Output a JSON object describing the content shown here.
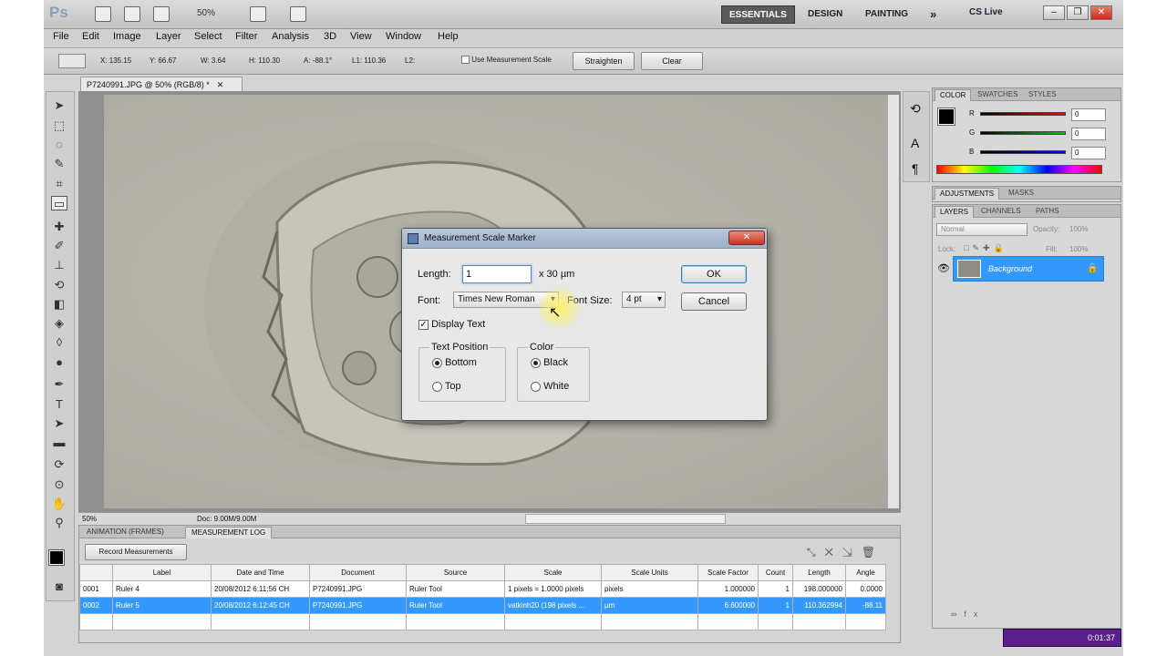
{
  "app": {
    "logo": "Ps",
    "zoom": "50%",
    "workspaces": [
      "ESSENTIALS",
      "DESIGN",
      "PAINTING"
    ],
    "more": "»",
    "cslive": "CS Live"
  },
  "menu": [
    "File",
    "Edit",
    "Image",
    "Layer",
    "Select",
    "Filter",
    "Analysis",
    "3D",
    "View",
    "Window",
    "Help"
  ],
  "options": {
    "x": "X: 135.15",
    "y": "Y: 66.67",
    "w": "W: 3.64",
    "h": "H: 110.30",
    "a": "A: -88.1°",
    "l1": "L1: 110.36",
    "l2": "L2:",
    "use_scale": "Use Measurement Scale",
    "straighten": "Straighten",
    "clear": "Clear"
  },
  "document": {
    "tab": "P7240991.JPG @ 50% (RGB/8) *",
    "zoom": "50%",
    "doc_size": "Doc: 9.00M/9.00M"
  },
  "dialog": {
    "title": "Measurement Scale Marker",
    "length_label": "Length:",
    "length_value": "1",
    "length_unit": "x 30 µm",
    "font_label": "Font:",
    "font_value": "Times New Roman",
    "size_label": "Font Size:",
    "size_value": "4 pt",
    "ok": "OK",
    "cancel": "Cancel",
    "display_text": "Display Text",
    "text_position": "Text Position",
    "bottom": "Bottom",
    "top": "Top",
    "color": "Color",
    "black": "Black",
    "white": "White"
  },
  "log": {
    "tabs": [
      "ANIMATION (FRAMES)",
      "MEASUREMENT LOG"
    ],
    "record": "Record Measurements",
    "columns": [
      "",
      "Label",
      "Date and Time",
      "Document",
      "Source",
      "Scale",
      "Scale Units",
      "Scale Factor",
      "Count",
      "Length",
      "Angle"
    ],
    "rows": [
      [
        "0001",
        "Ruler 4",
        "20/08/2012 6:11:56 CH",
        "P7240991.JPG",
        "Ruler Tool",
        "1 pixels = 1.0000 pixels",
        "pixels",
        "1.000000",
        "1",
        "198.000000",
        "0.0000"
      ],
      [
        "0002",
        "Ruler 5",
        "20/08/2012 6:12:45 CH",
        "P7240991.JPG",
        "Ruler Tool",
        "vatkinh20 (198 pixels ...",
        "µm",
        "6.600000",
        "1",
        "110.362994",
        "-88.11"
      ]
    ]
  },
  "color_panel": {
    "tabs": [
      "COLOR",
      "SWATCHES",
      "STYLES"
    ],
    "channels": [
      {
        "label": "R",
        "value": "0",
        "color": "#ff0000"
      },
      {
        "label": "G",
        "value": "0",
        "color": "#00c000"
      },
      {
        "label": "B",
        "value": "0",
        "color": "#0000ff"
      }
    ]
  },
  "adj_panel": {
    "tabs": [
      "ADJUSTMENTS",
      "MASKS"
    ]
  },
  "layers_panel": {
    "tabs": [
      "LAYERS",
      "CHANNELS",
      "PATHS"
    ],
    "blend": "Normal",
    "opacity_label": "Opacity:",
    "opacity": "100%",
    "lock_label": "Lock:",
    "fill_label": "Fill:",
    "fill": "100%",
    "layer_name": "Background"
  },
  "recorder": {
    "time": "0:01:37"
  }
}
